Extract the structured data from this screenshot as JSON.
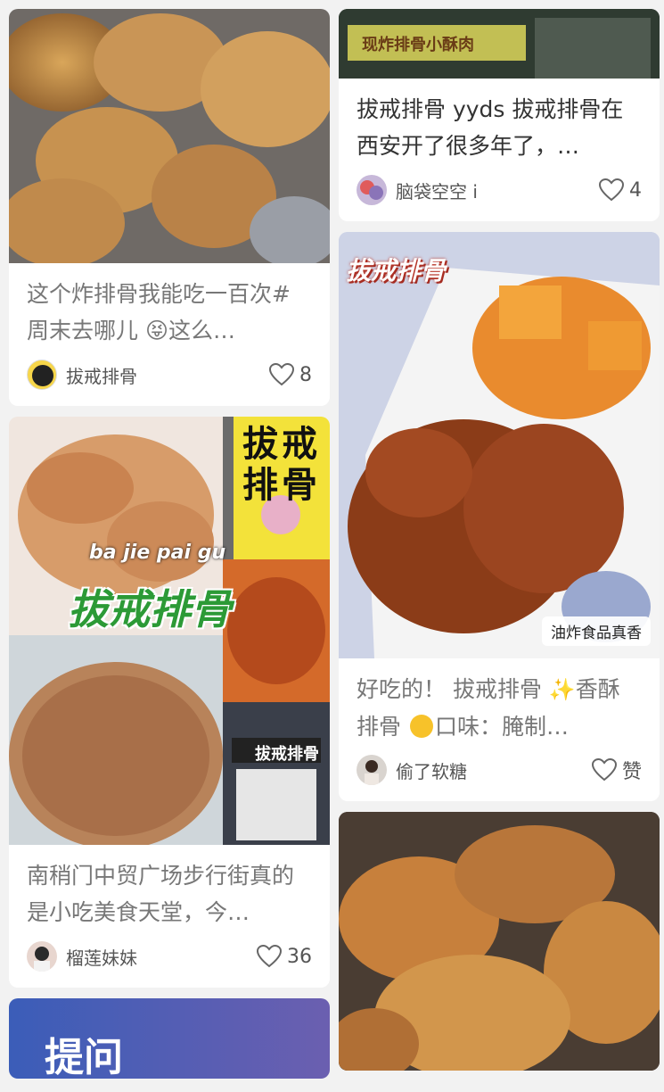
{
  "left_column": [
    {
      "title": "这个炸排骨我能吃一百次#周末去哪儿 😝这么…",
      "author": "拔戒排骨",
      "likes": "8"
    },
    {
      "image_text": {
        "shop_sign": "拔戒排骨",
        "pinyin": "ba jie pai gu",
        "big_title": "拔戒排骨",
        "storefront_sign": "拔戒排骨"
      },
      "title": "南稍门中贸广场步行街真的是小吃美食天堂，今…",
      "author": "榴莲妹妹",
      "likes": "36"
    },
    {
      "image_text": {
        "partial": "提问"
      }
    }
  ],
  "right_column": [
    {
      "image_text": {
        "storefront_sign": "现炸排骨小酥肉"
      },
      "title": "拔戒排骨 yyds 拔戒排骨在西安开了很多年了，…",
      "author": "脑袋空空 i",
      "likes": "4"
    },
    {
      "image_text": {
        "overlay_title": "拔戒排骨",
        "tag": "油炸食品真香"
      },
      "title_parts": [
        "好吃的！ 拔戒排骨 ",
        "香酥排骨 ",
        "口味：腌制…"
      ],
      "author": "偷了软糖",
      "likes": "赞"
    },
    {}
  ],
  "icons": {
    "like": "heart-outline-icon"
  }
}
